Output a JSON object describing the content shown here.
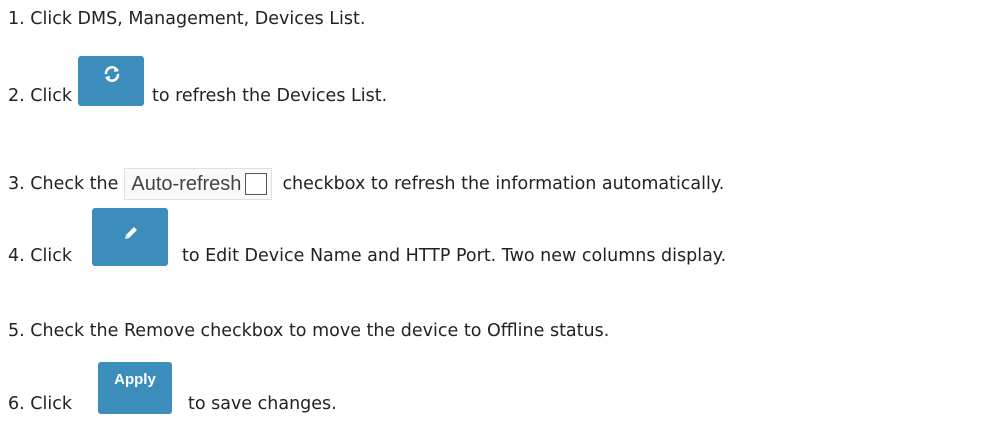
{
  "steps": {
    "s1": "1. Click DMS, Management, Devices List.",
    "s2_before": "2. Click",
    "s2_after": "to refresh the Devices List.",
    "s3_before": "3. Check the",
    "s3_after": "checkbox to refresh the information automatically.",
    "s4_before": "4. Click",
    "s4_after": "to Edit Device Name and HTTP Port. Two new columns display.",
    "s5": "5. Check the Remove checkbox to move the device to Offline status.",
    "s6_before": "6. Click",
    "s6_after": "to save changes."
  },
  "widgets": {
    "refresh_icon": "refresh-icon",
    "auto_refresh_label": "Auto-refresh",
    "auto_refresh_checked": false,
    "edit_icon": "pencil-icon",
    "apply_label": "Apply",
    "button_color": "#3c8dbc"
  }
}
